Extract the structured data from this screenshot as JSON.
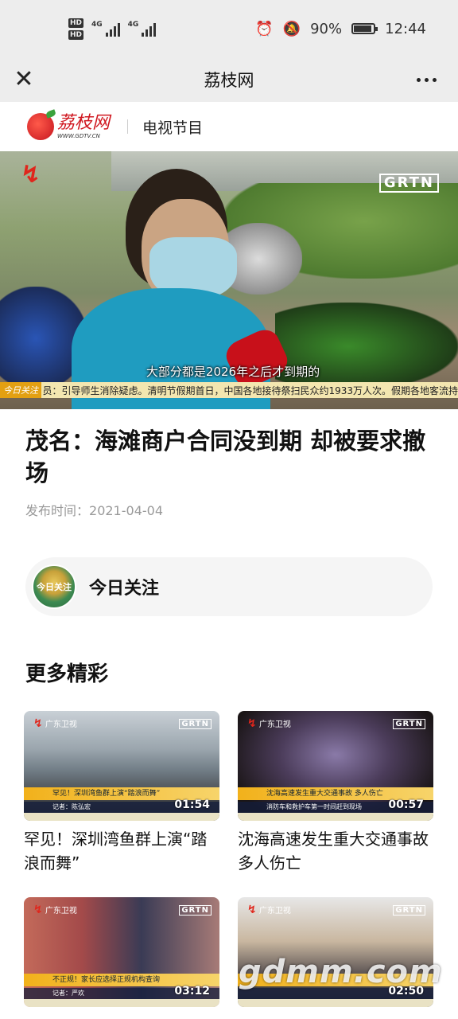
{
  "status_bar": {
    "network_badges": [
      "HD",
      "HD"
    ],
    "network_labels": [
      "4G",
      "4G"
    ],
    "battery": "90%",
    "battery_level": 0.9,
    "time": "12:44"
  },
  "navbar": {
    "title": "荔枝网",
    "close_icon": "close-icon",
    "more_icon": "more-dots-icon"
  },
  "brand": {
    "logo_text": "荔枝网",
    "logo_url": "WWW.GDTV.CN",
    "section": "电视节目"
  },
  "hero": {
    "channel_mark": "GRTN",
    "subtitle": "大部分都是2026年之后才到期的",
    "ticker_tag": "今日关注",
    "ticker_text": "员：引导师生消除疑虑。清明节假期首日，中国各地接待祭扫民众约1933万人次。假期各地客流持"
  },
  "article": {
    "title": "茂名：海滩商户合同没到期 却被要求撤场",
    "publish_label": "发布时间：",
    "publish_date": "2021-04-04"
  },
  "follow": {
    "avatar_text": "今日关注",
    "label": "今日关注"
  },
  "more": {
    "title": "更多精彩",
    "cards": [
      {
        "title": "罕见！深圳湾鱼群上演“踏浪而舞”",
        "duration": "01:54",
        "channel": "广东卫视",
        "band": "罕见！深圳湾鱼群上演“踏浪而舞”",
        "band2": "记者：陈弘宏",
        "grtn": "GRTN"
      },
      {
        "title": "沈海高速发生重大交通事故 多人伤亡",
        "duration": "00:57",
        "channel": "广东卫视",
        "band": "沈海高速发生重大交通事故 多人伤亡",
        "band2": "消防车和救护车第一时间赶到现场",
        "grtn": "GRTN"
      },
      {
        "title": "",
        "duration": "03:12",
        "channel": "广东卫视",
        "band": "不正规！家长应选择正规机构查询",
        "band2": "记者：严欢",
        "grtn": "GRTN"
      },
      {
        "title": "",
        "duration": "02:50",
        "channel": "广东卫视",
        "band": "",
        "band2": "",
        "grtn": "GRTN"
      }
    ]
  },
  "watermark": "gdmm.com"
}
